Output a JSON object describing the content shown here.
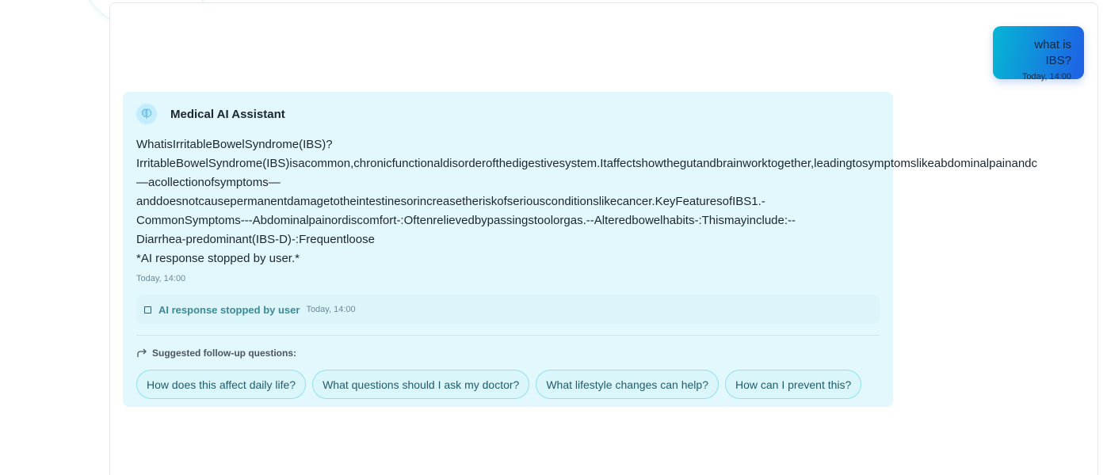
{
  "user_message": {
    "text": "what is IBS?",
    "time": "Today, 14:00"
  },
  "assistant": {
    "name": "Medical AI Assistant",
    "icon": "brain-icon",
    "lines": [
      "WhatisIrritableBowelSyndrome(IBS)?",
      "IrritableBowelSyndrome(IBS)isacommon,chronicfunctionaldisorderofthedigestivesystem.Itaffectshowthegutandbrainworktogether,leadingtosymptomslikeabdominalpainandc",
      "—acollectionofsymptoms—",
      "anddoesnotcausepermanentdamagetotheintestinesorincreasetheriskofseriousconditionslikecancer.KeyFeaturesofIBS1.-",
      "CommonSymptoms---Abdominalpainordiscomfort-:Oftenrelievedbypassingstoolorgas.--Alteredbowelhabits-:Thismayinclude:--",
      "Diarrhea-predominant(IBS-D)-:Frequentloose",
      "*AI response stopped by user.*"
    ],
    "time": "Today, 14:00",
    "stopped_notice": {
      "label": "AI response stopped by user",
      "time": "Today, 14:00",
      "icon": "stop-square-icon"
    },
    "followup": {
      "title": "Suggested follow-up questions:",
      "icon": "forward-arrow-icon",
      "questions": [
        "How does this affect daily life?",
        "What questions should I ask my doctor?",
        "What lifestyle changes can help?",
        "How can I prevent this?"
      ]
    }
  },
  "colors": {
    "card_bg": "#e3f8fc",
    "user_gradient_start": "#06b6d4",
    "user_gradient_end": "#1f5fe6",
    "chip_border": "#8fe0ef",
    "accent_text": "#3c8a97"
  }
}
